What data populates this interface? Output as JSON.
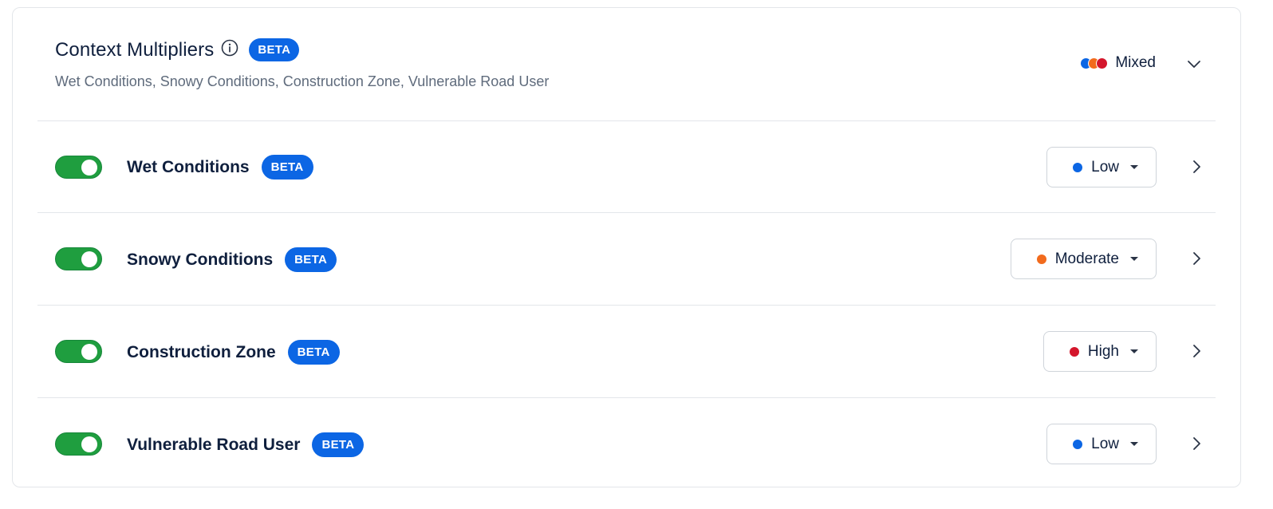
{
  "header": {
    "title": "Context Multipliers",
    "beta": "BETA",
    "subtitle": "Wet Conditions, Snowy Conditions, Construction Zone, Vulnerable Road User",
    "status_label": "Mixed",
    "status_dot_colors": [
      "#0c66e4",
      "#f26b1d",
      "#d4162c"
    ]
  },
  "severity_colors": {
    "Low": "#0c66e4",
    "Moderate": "#f26b1d",
    "High": "#d4162c"
  },
  "rows": [
    {
      "name": "Wet Conditions",
      "beta": "BETA",
      "enabled": true,
      "severity": "Low"
    },
    {
      "name": "Snowy Conditions",
      "beta": "BETA",
      "enabled": true,
      "severity": "Moderate"
    },
    {
      "name": "Construction Zone",
      "beta": "BETA",
      "enabled": true,
      "severity": "High"
    },
    {
      "name": "Vulnerable Road User",
      "beta": "BETA",
      "enabled": true,
      "severity": "Low"
    }
  ]
}
